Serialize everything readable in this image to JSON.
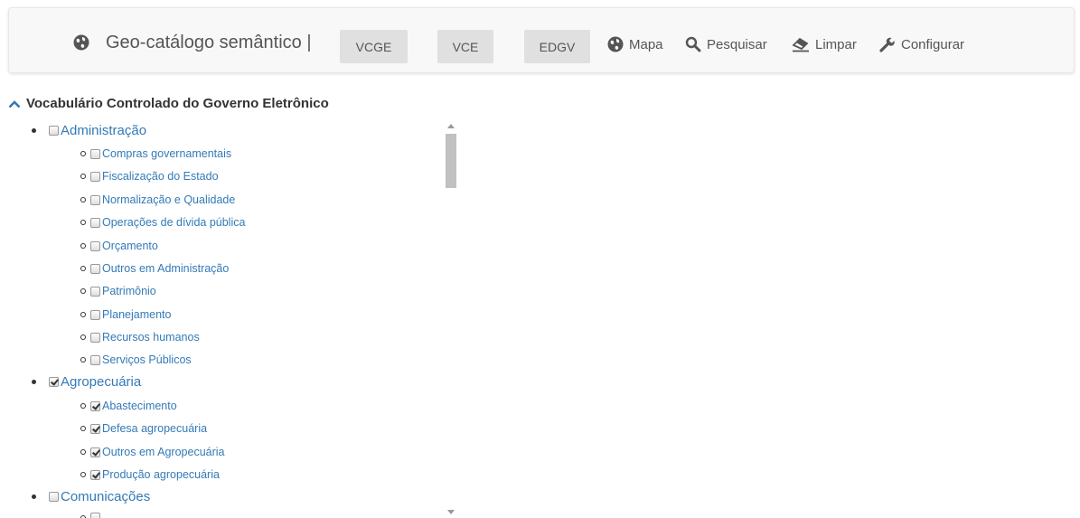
{
  "navbar": {
    "brand": "Geo-catálogo semântico |",
    "vocab_buttons": [
      "VCGE",
      "VCE",
      "EDGV"
    ],
    "links": {
      "map": "Mapa",
      "search": "Pesquisar",
      "clear": "Limpar",
      "settings": "Configurar"
    }
  },
  "section": {
    "title": "Vocabulário Controlado do Governo Eletrônico"
  },
  "tree": {
    "administracao": {
      "label": "Administração",
      "checked": false,
      "children": [
        "Compras governamentais",
        "Fiscalização do Estado",
        "Normalização e Qualidade",
        "Operações de dívida pública",
        "Orçamento",
        "Outros em Administração",
        "Patrimônio",
        "Planejamento",
        "Recursos humanos",
        "Serviços Públicos"
      ]
    },
    "agropecuaria": {
      "label": "Agropecuária",
      "checked": true,
      "children": [
        "Abastecimento",
        "Defesa agropecuária",
        "Outros em Agropecuária",
        "Produção agropecuária"
      ]
    },
    "comunicacoes": {
      "label": "Comunicações",
      "checked": false
    }
  }
}
